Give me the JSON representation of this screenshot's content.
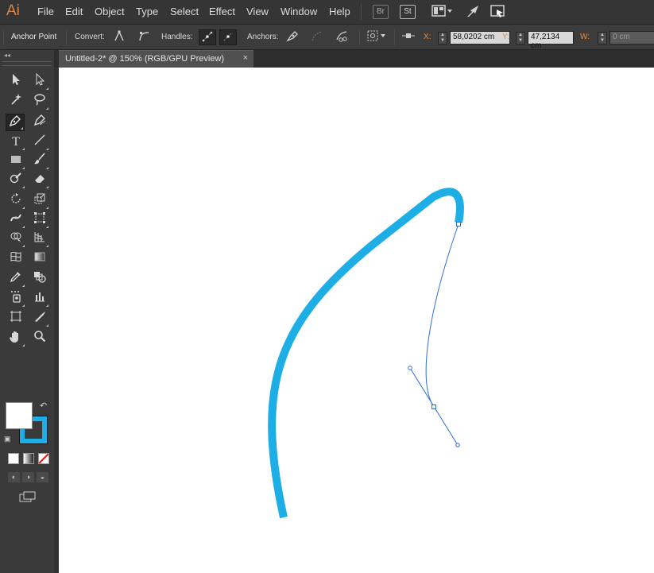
{
  "app": {
    "logo_text": "Ai",
    "brand_color": "#d5874b"
  },
  "menu": {
    "items": [
      "File",
      "Edit",
      "Object",
      "Type",
      "Select",
      "Effect",
      "View",
      "Window",
      "Help"
    ],
    "bridge_label": "Br",
    "stock_label": "St"
  },
  "control_bar": {
    "selection_label": "Anchor Point",
    "convert_label": "Convert:",
    "handles_label": "Handles:",
    "anchors_label": "Anchors:",
    "x_label": "X:",
    "x_value": "58,0202 cm",
    "y_label": "Y:",
    "y_value": "47,2134 cm",
    "w_label": "W:",
    "w_value": "0 cm"
  },
  "document": {
    "tab_title": "Untitled-2* @ 150% (RGB/GPU Preview)",
    "close_glyph": "×"
  },
  "colors": {
    "stroke_color": "#1eaee6",
    "fill_color": "#ffffff",
    "path_selection_color": "#2f6fd6"
  },
  "tools": [
    {
      "name": "selection-tool",
      "icon": "arrow"
    },
    {
      "name": "direct-selection-tool",
      "icon": "hollow-arrow"
    },
    {
      "name": "magic-wand-tool",
      "icon": "wand"
    },
    {
      "name": "lasso-tool",
      "icon": "lasso"
    },
    {
      "name": "pen-tool",
      "icon": "pen",
      "active": true
    },
    {
      "name": "curvature-tool",
      "icon": "pen-curve"
    },
    {
      "name": "type-tool",
      "icon": "T"
    },
    {
      "name": "line-segment-tool",
      "icon": "line"
    },
    {
      "name": "rectangle-tool",
      "icon": "rectangle"
    },
    {
      "name": "paintbrush-tool",
      "icon": "brush"
    },
    {
      "name": "shaper-tool",
      "icon": "shaper"
    },
    {
      "name": "eraser-tool",
      "icon": "eraser"
    },
    {
      "name": "rotate-tool",
      "icon": "rotate"
    },
    {
      "name": "scale-tool",
      "icon": "scale"
    },
    {
      "name": "width-tool",
      "icon": "width"
    },
    {
      "name": "free-transform-tool",
      "icon": "free-transform"
    },
    {
      "name": "shape-builder-tool",
      "icon": "shape-builder"
    },
    {
      "name": "perspective-grid-tool",
      "icon": "perspective"
    },
    {
      "name": "mesh-tool",
      "icon": "mesh"
    },
    {
      "name": "gradient-tool",
      "icon": "gradient"
    },
    {
      "name": "eyedropper-tool",
      "icon": "eyedropper"
    },
    {
      "name": "blend-tool",
      "icon": "blend"
    },
    {
      "name": "symbol-sprayer-tool",
      "icon": "symbol-sprayer"
    },
    {
      "name": "column-graph-tool",
      "icon": "graph"
    },
    {
      "name": "artboard-tool",
      "icon": "artboard"
    },
    {
      "name": "slice-tool",
      "icon": "slice"
    },
    {
      "name": "hand-tool",
      "icon": "hand"
    },
    {
      "name": "zoom-tool",
      "icon": "zoom"
    }
  ]
}
